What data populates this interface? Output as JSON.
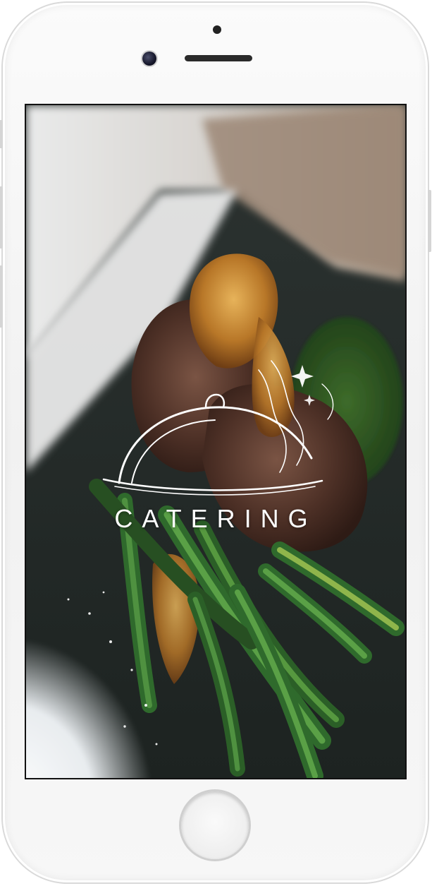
{
  "device": {
    "name": "iPhone",
    "frame_color": "#f5f5f5"
  },
  "splash": {
    "brand_name": "CATERING",
    "logo_icon": "cloche-icon",
    "background": "steak-with-green-beans-photo"
  },
  "icons": {
    "front_camera": "camera-icon",
    "speaker": "speaker-icon",
    "home": "home-button-icon"
  }
}
